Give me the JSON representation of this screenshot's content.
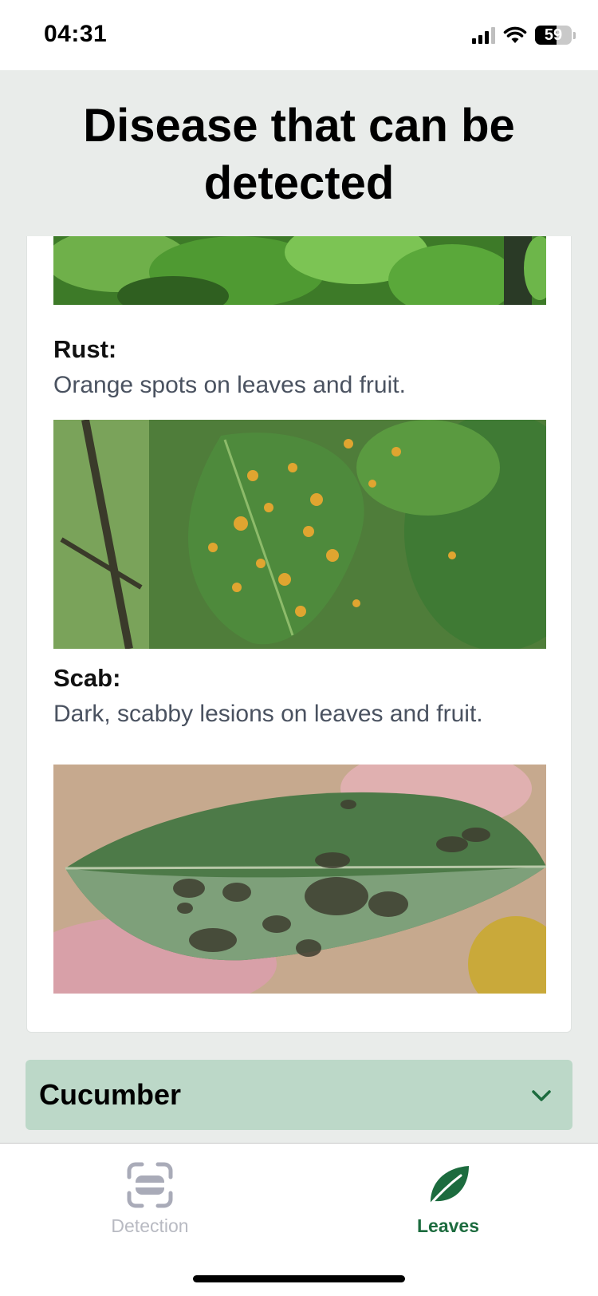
{
  "status": {
    "time": "04:31",
    "battery": "59"
  },
  "title": "Disease that can be detected",
  "diseases": [
    {
      "name": "Rust:",
      "description": "Orange spots on leaves and fruit."
    },
    {
      "name": "Scab:",
      "description": "Dark, scabby lesions on leaves and fruit."
    }
  ],
  "accordion": {
    "label": "Cucumber"
  },
  "tabs": [
    {
      "label": "Detection",
      "icon": "scan-icon",
      "active": false
    },
    {
      "label": "Leaves",
      "icon": "leaf-icon",
      "active": true
    }
  ],
  "colors": {
    "accent": "#1c6b3e",
    "accordion_bg": "#bcd8c8",
    "inactive": "#b8bac2",
    "background": "#e9ecea"
  }
}
